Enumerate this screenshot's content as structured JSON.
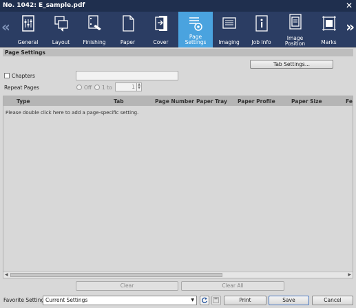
{
  "window": {
    "title": "No. 1042: E_sample.pdf"
  },
  "toolbar": {
    "tabs": [
      {
        "label": "General",
        "icon": "general-icon"
      },
      {
        "label": "Layout",
        "icon": "layout-icon"
      },
      {
        "label": "Finishing",
        "icon": "finishing-icon"
      },
      {
        "label": "Paper",
        "icon": "paper-icon"
      },
      {
        "label": "Cover",
        "icon": "cover-icon"
      },
      {
        "label": "Page Settings",
        "icon": "page-settings-icon",
        "active": true
      },
      {
        "label": "Imaging",
        "icon": "imaging-icon"
      },
      {
        "label": "Job Info",
        "icon": "job-info-icon"
      },
      {
        "label": "Image\nPosition",
        "icon": "image-position-icon"
      },
      {
        "label": "Marks",
        "icon": "marks-icon"
      }
    ]
  },
  "page_settings": {
    "header": "Page Settings",
    "tab_settings_button": "Tab Settings...",
    "chapters_label": "Chapters",
    "chapters_value": "",
    "repeat_pages_label": "Repeat Pages",
    "repeat_off_label": "Off",
    "repeat_1to_label": "1 to",
    "repeat_value": "1"
  },
  "grid": {
    "columns": [
      "Type",
      "Tab",
      "Page Number",
      "Paper Tray",
      "Paper Profile",
      "Paper Size",
      "Fee"
    ],
    "empty_message": "Please double click here to add a page-specific setting."
  },
  "actions": {
    "clear": "Clear",
    "clear_all": "Clear All"
  },
  "footer": {
    "favorite_label": "Favorite Setting",
    "favorite_value": "Current Settings",
    "print": "Print",
    "save": "Save",
    "cancel": "Cancel"
  },
  "colors": {
    "titlebar": "#1f2f4e",
    "toolbar": "#2b3d63",
    "active_tab": "#4aa3df"
  }
}
